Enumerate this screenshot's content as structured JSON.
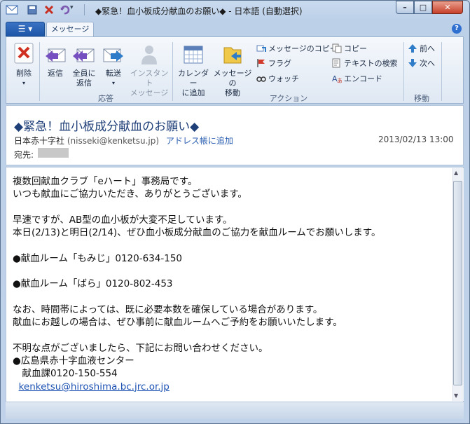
{
  "window": {
    "title": "◆緊急！血小板成分献血のお願い◆ - 日本語 (自動選択)",
    "minimize": "–",
    "maximize": "□",
    "close": "✕"
  },
  "ribbon": {
    "file_tab": "☰ ▾",
    "tabs": [
      {
        "label": "メッセージ"
      }
    ],
    "help": "?",
    "delete": {
      "label": "削除",
      "arrow": "▾"
    },
    "respond": {
      "group": "応答",
      "reply": "返信",
      "reply_all": [
        "全員に",
        "返信"
      ],
      "forward": "転送",
      "forward_arrow": "▾",
      "im": [
        "インスタント",
        "メッセージ"
      ]
    },
    "calendar": [
      "カレンダー",
      "に追加"
    ],
    "move_msg": [
      "メッセージの",
      "移動"
    ],
    "actions": {
      "group": "アクション",
      "copy_message": "メッセージのコピー",
      "flag": "フラグ",
      "watch": "ウォッチ",
      "copy": "コピー",
      "find_text": "テキストの検索",
      "encode": "エンコード"
    },
    "move": {
      "group": "移動",
      "prev": "前へ",
      "next": "次へ"
    }
  },
  "message": {
    "subject": "◆緊急！血小板成分献血のお願い◆",
    "from_name": "日本赤十字社",
    "from_addr": "(nisseki@kenketsu.jp)",
    "add_to_contacts": "アドレス帳に追加",
    "date": "2013/02/13 13:00",
    "to_label": "宛先:",
    "body": [
      "複数回献血クラブ「eハート」事務局です。",
      "いつも献血にご協力いただき、ありがとうございます。",
      "",
      "早速ですが、AB型の血小板が大変不足しています。",
      "本日(2/13)と明日(2/14)、ぜひ血小板成分献血のご協力を献血ルームでお願いします。",
      "",
      "●献血ルーム「もみじ」0120-634-150",
      "",
      "●献血ルーム「ばら」0120-802-453",
      "",
      "なお、時間帯によっては、既に必要本数を確保している場合があります。",
      "献血にお越しの場合は、ぜひ事前に献血ルームへご予約をお願いいたします。",
      "",
      "不明な点がございましたら、下記にお問い合わせください。",
      "●広島県赤十字血液センター",
      "　献血課0120-150-554"
    ],
    "email_link": "kenketsu@hiroshima.bc.jrc.or.jp"
  },
  "colors": {
    "accent": "#1f57a8",
    "subject": "#1f3f78",
    "link": "#1d52b3"
  }
}
